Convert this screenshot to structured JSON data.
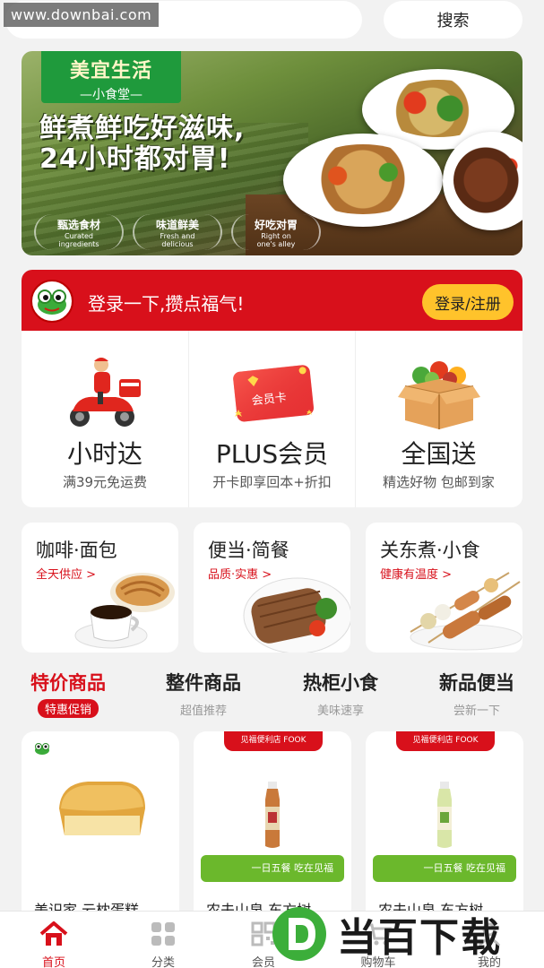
{
  "watermark_top": "www.downbai.com",
  "header": {
    "search_button": "搜索"
  },
  "banner": {
    "brand_line1": "美宜生活",
    "brand_line2": "—小食堂—",
    "slogan_line1": "鲜煮鲜吃好滋味,",
    "slogan_line2": "24小时都对胃!",
    "badges": [
      {
        "title": "甄选食材",
        "sub1": "Curated",
        "sub2": "ingredients"
      },
      {
        "title": "味道鲜美",
        "sub1": "Fresh and",
        "sub2": "delicious"
      },
      {
        "title": "好吃对胃",
        "sub1": "Right on",
        "sub2": "one's alley"
      }
    ]
  },
  "login": {
    "prompt": "登录一下,攒点福气!",
    "button": "登录/注册"
  },
  "services": [
    {
      "title": "小时达",
      "sub": "满39元免运费"
    },
    {
      "title": "PLUS会员",
      "sub": "开卡即享回本+折扣",
      "card_label": "会员卡"
    },
    {
      "title": "全国送",
      "sub": "精选好物 包邮到家"
    }
  ],
  "categories": [
    {
      "title": "咖啡·面包",
      "sub": "全天供应 >"
    },
    {
      "title": "便当·简餐",
      "sub": "品质·实惠 >"
    },
    {
      "title": "关东煮·小食",
      "sub": "健康有温度 >"
    }
  ],
  "tabs": [
    {
      "label": "特价商品",
      "sub": "特惠促销"
    },
    {
      "label": "整件商品",
      "sub": "超值推荐"
    },
    {
      "label": "热柜小食",
      "sub": "美味速享"
    },
    {
      "label": "新品便当",
      "sub": "尝新一下"
    }
  ],
  "products": [
    {
      "name": "美识家 云枕蛋糕"
    },
    {
      "name": "农夫山泉 东方树",
      "top_label": "见福便利店 FOOK",
      "band": "一日五餐 吃在见福"
    },
    {
      "name": "农夫山泉 东方树",
      "top_label": "见福便利店 FOOK",
      "band": "一日五餐 吃在见福"
    }
  ],
  "bottom_nav": [
    {
      "label": "首页"
    },
    {
      "label": "分类"
    },
    {
      "label": "会员"
    },
    {
      "label": "购物车"
    },
    {
      "label": "我的"
    }
  ],
  "watermark_bottom": "当百下载",
  "colors": {
    "primary_red": "#d8101b",
    "accent_yellow": "#ffc32b",
    "brand_green": "#1f9a3c"
  }
}
